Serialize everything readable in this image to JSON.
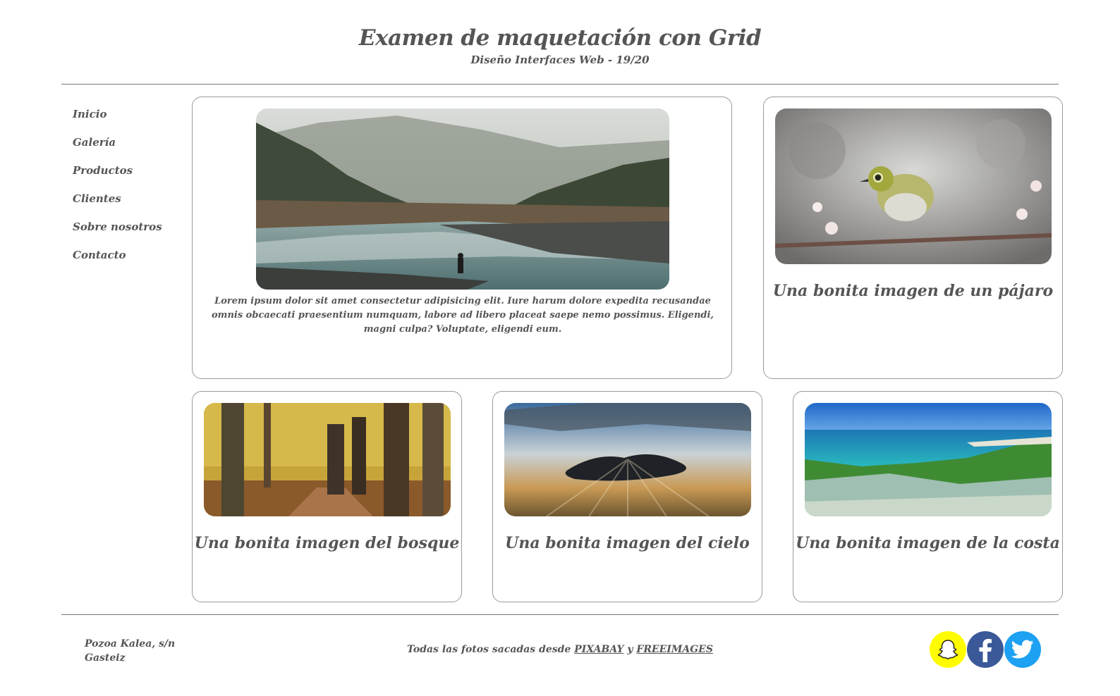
{
  "header": {
    "title": "Examen de maquetación con Grid",
    "subtitle": "Diseño Interfaces Web - 19/20"
  },
  "nav": {
    "items": [
      {
        "label": "Inicio"
      },
      {
        "label": "Galería"
      },
      {
        "label": "Productos"
      },
      {
        "label": "Clientes"
      },
      {
        "label": "Sobre nosotros"
      },
      {
        "label": "Contacto"
      }
    ]
  },
  "main": {
    "text": "Lorem ipsum dolor sit amet consectetur adipisicing elit. Iure harum dolore expedita recusandae omnis obcaecati praesentium numquam, labore ad libero placeat saepe nemo possimus. Eligendi, magni culpa? Voluptate, eligendi eum."
  },
  "cards": {
    "bird": {
      "caption": "Una bonita imagen de un pájaro"
    },
    "forest": {
      "caption": "Una bonita imagen del bosque"
    },
    "sky": {
      "caption": "Una bonita imagen del cielo"
    },
    "coast": {
      "caption": "Una bonita imagen de la costa"
    }
  },
  "footer": {
    "address_line1": "Pozoa Kalea, s/n",
    "address_line2": "Gasteiz",
    "credits_prefix": "Todas las fotos sacadas desde",
    "link1": "PIXABAY",
    "conjunction": "y",
    "link2": "FREEIMAGES"
  },
  "social": {
    "icons": [
      "snapchat-icon",
      "facebook-icon",
      "twitter-icon"
    ],
    "colors": {
      "snapchat": "#FFFC00",
      "facebook": "#3b5998",
      "twitter": "#1DA1F2"
    }
  }
}
